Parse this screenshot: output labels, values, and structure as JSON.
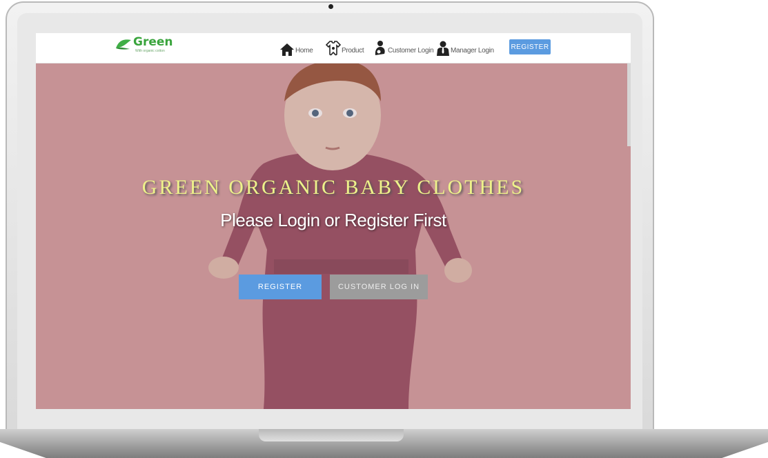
{
  "navbar": {
    "logo_text": "Green",
    "logo_tagline": "With organic cotton",
    "items": [
      {
        "label": "Home",
        "icon": "home-icon"
      },
      {
        "label": "Product",
        "icon": "baby-clothes-icon"
      },
      {
        "label": "Customer Login",
        "icon": "customer-icon"
      },
      {
        "label": "Manager Login",
        "icon": "manager-icon"
      }
    ],
    "register_label": "REGISTER"
  },
  "hero": {
    "title": "GREEN ORGANIC BABY CLOTHES",
    "subtitle": "Please Login or Register First",
    "register_button": "REGISTER",
    "login_button": "CUSTOMER LOG IN"
  },
  "colors": {
    "accent": "#5b9be0",
    "brand_green": "#39a43c",
    "hero_background": "#d9a4a6",
    "title_color": "#eef28a",
    "secondary_button": "#9c9c9c"
  }
}
